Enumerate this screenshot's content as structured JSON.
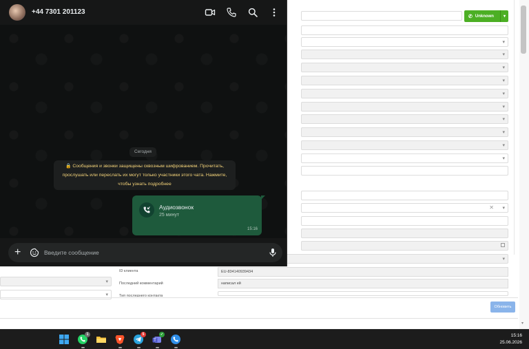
{
  "whatsapp": {
    "contact_name": "+44 7301 201123",
    "date_divider": "Сегодня",
    "encryption_notice_line1": "🔒 Сообщения и звонки защищены сквозным шифрованием. Прочитать,",
    "encryption_notice_line2": "прослушать или переслать их могут только участники этого чата. Нажмите,",
    "encryption_notice_line3": "чтобы узнать подробнее",
    "call_message": {
      "title": "Аудиозвонок",
      "duration": "25 минут",
      "time": "15:16"
    },
    "input_placeholder": "Введите сообщение",
    "colors": {
      "accent": "#1e5a3c",
      "notice_text": "#f5d47a",
      "background": "#161717"
    }
  },
  "crm": {
    "status_button_label": "Unknown",
    "fields": {
      "client_id_label": "ID клиента",
      "client_id_value": "EU-834140939434",
      "last_comment_label": "Последний комментарий",
      "last_comment_value": "написал ей",
      "truncated_label": "Тип последнего контакта"
    },
    "update_button_label": "Обновить",
    "colors": {
      "status_green": "#4caf24",
      "update_blue": "#8ab4ea"
    }
  },
  "taskbar": {
    "apps": [
      {
        "icon": "windows-start-icon"
      },
      {
        "icon": "whatsapp-icon",
        "badge": "1"
      },
      {
        "icon": "file-explorer-icon"
      },
      {
        "icon": "brave-browser-icon"
      },
      {
        "icon": "telegram-icon",
        "badge": "5"
      },
      {
        "icon": "teams-icon"
      },
      {
        "icon": "calls-app-icon"
      }
    ],
    "time": "15:16",
    "date": "25.06.2026"
  }
}
